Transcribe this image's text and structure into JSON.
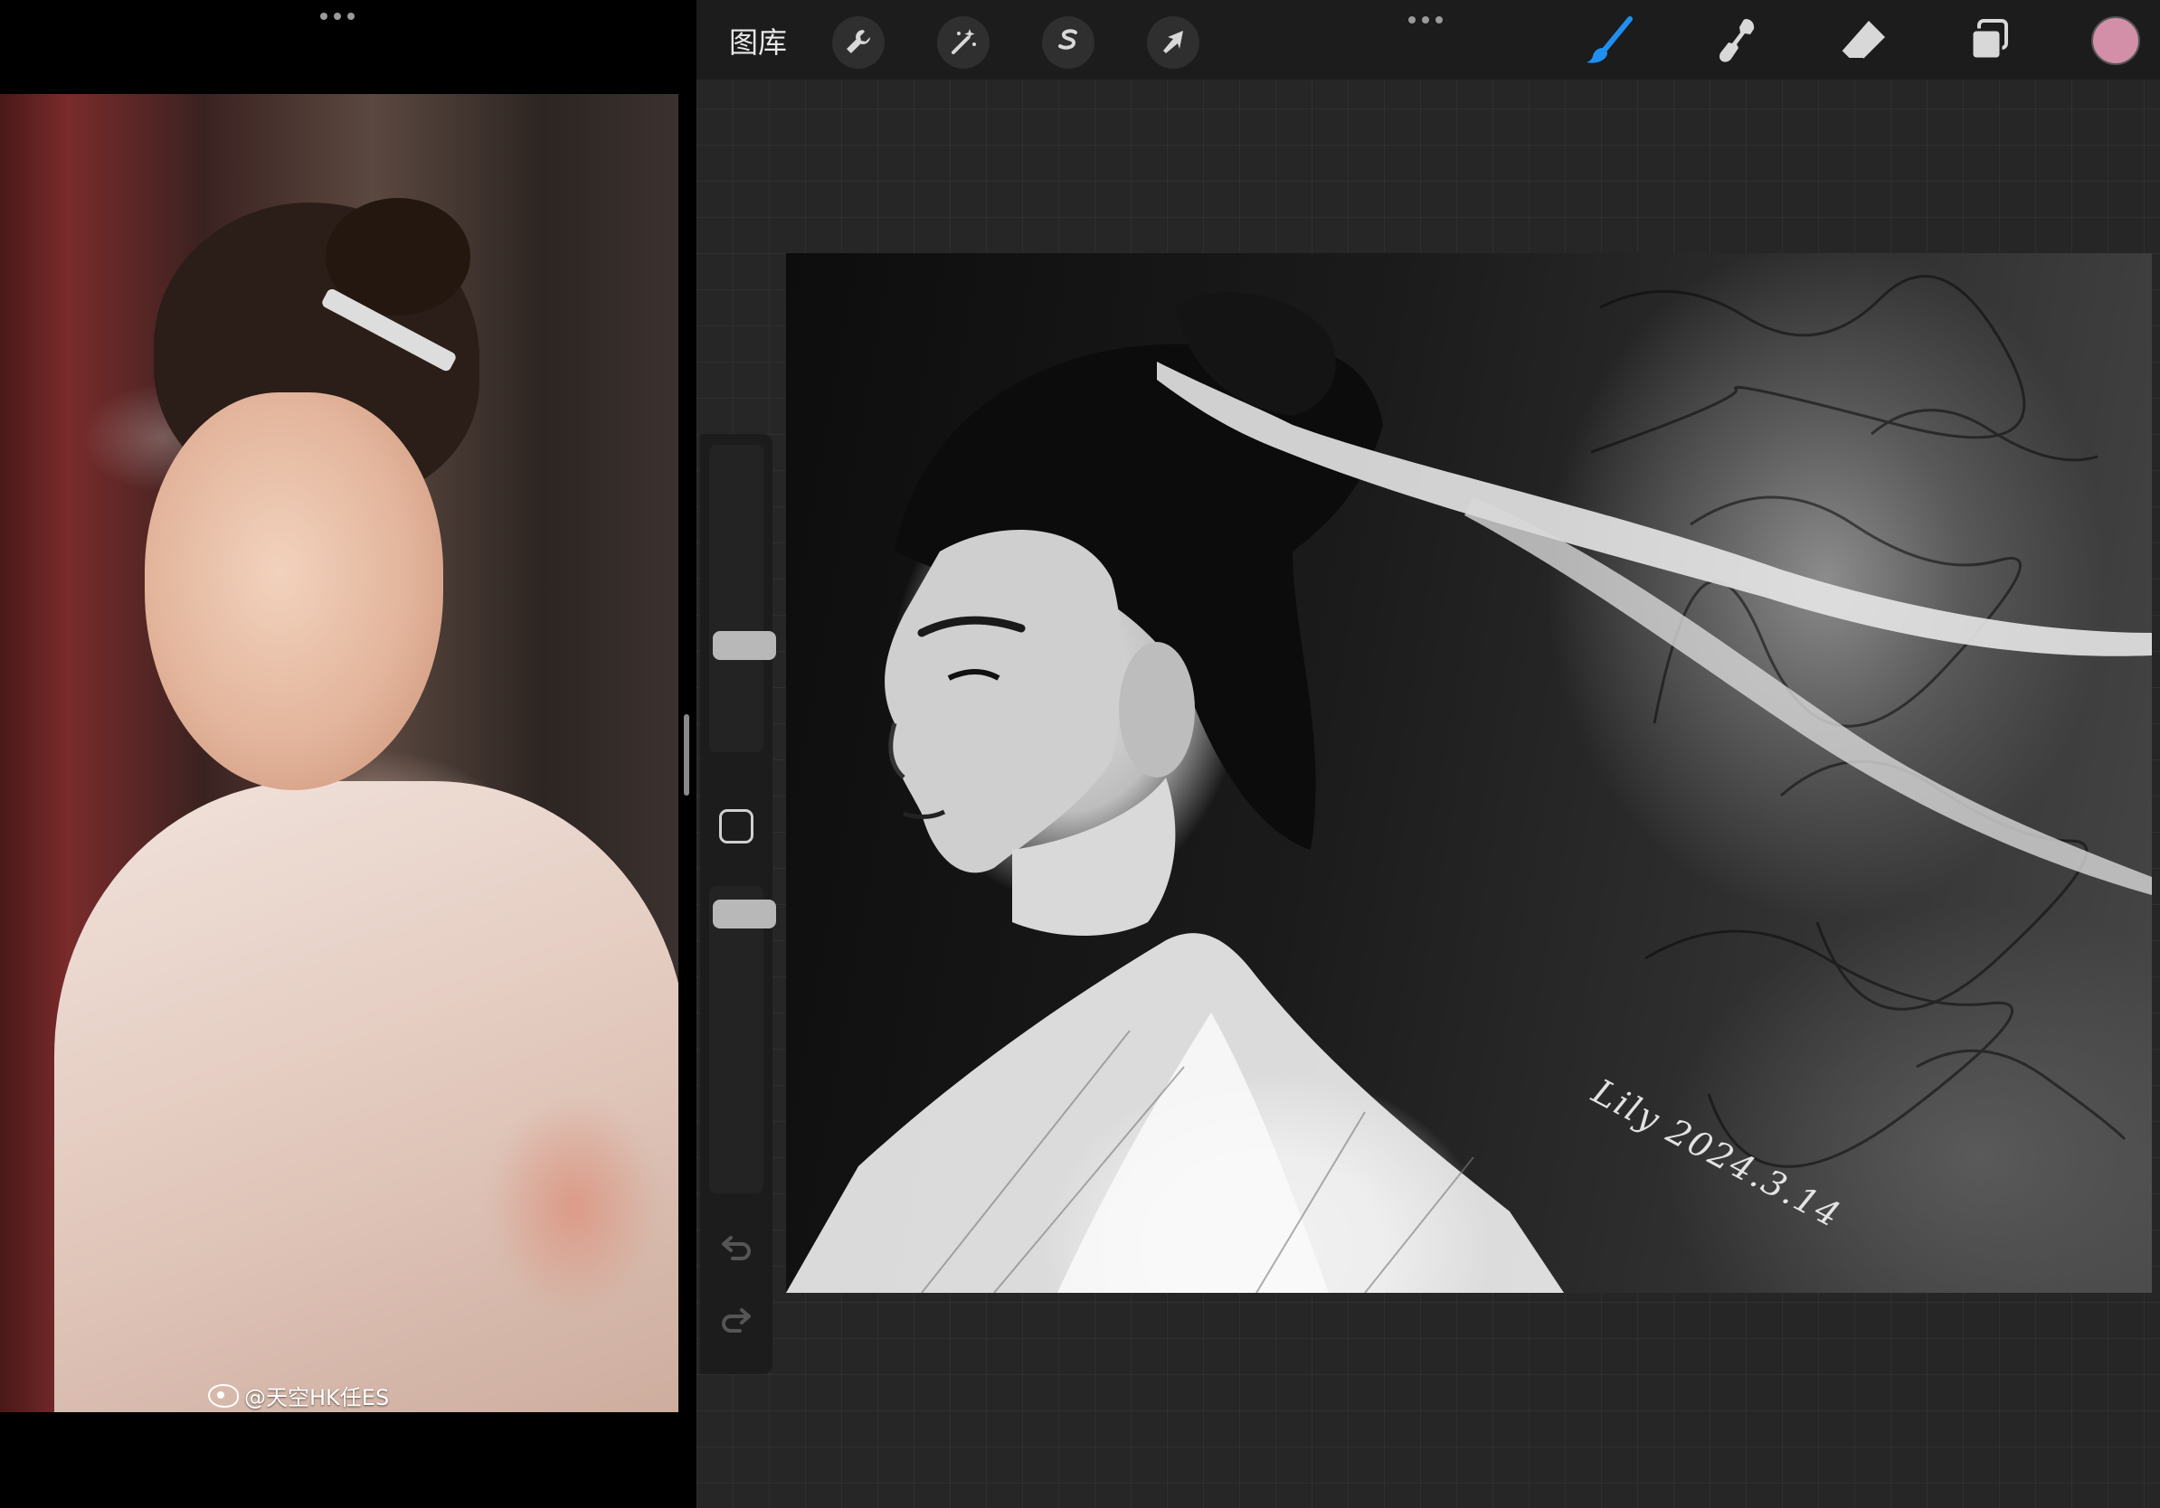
{
  "left_pane": {
    "watermark": "@天空HK任ES"
  },
  "toolbar": {
    "gallery_label": "图库",
    "actions_icon": "wrench-icon",
    "adjustments_icon": "magic-wand-icon",
    "selection_icon": "selection-s-icon",
    "transform_icon": "arrow-cursor-icon",
    "brush_icon": "brush-icon",
    "smudge_icon": "smudge-icon",
    "eraser_icon": "eraser-icon",
    "layers_icon": "layers-icon",
    "brush_active_color": "#1f8ff0",
    "current_color": "#d28fa7"
  },
  "sidebar": {
    "brush_size": 0.33,
    "brush_opacity": 0.95,
    "undo_icon": "undo-icon",
    "redo_icon": "redo-icon"
  },
  "canvas": {
    "signature": "Lily 2024.3.14"
  }
}
